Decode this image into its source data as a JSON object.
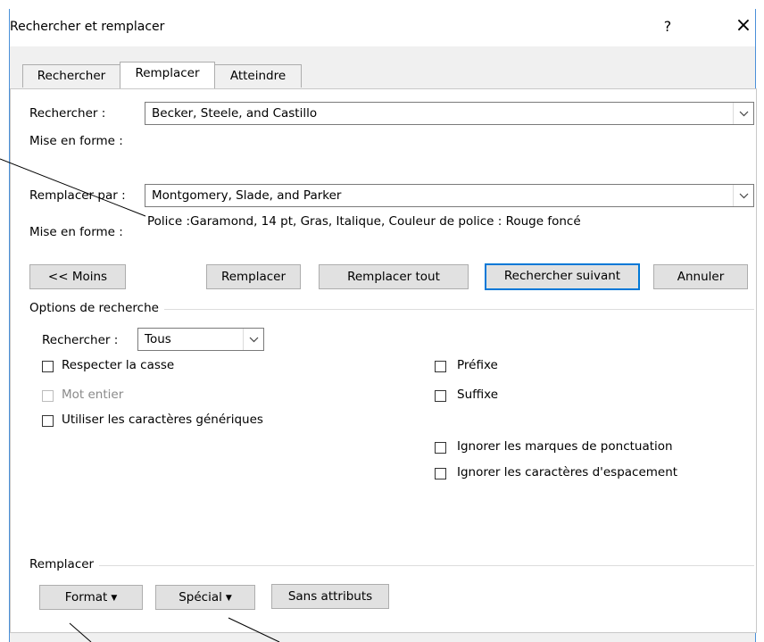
{
  "window": {
    "title": "Rechercher et remplacer",
    "help_label": "?",
    "close_label": "×"
  },
  "tabs": [
    {
      "label": "Rechercher",
      "active": false
    },
    {
      "label": "Remplacer",
      "active": true
    },
    {
      "label": "Atteindre",
      "active": false
    }
  ],
  "find": {
    "label": "Rechercher :",
    "value": "Becker, Steele, and Castillo",
    "format_label": "Mise en forme :"
  },
  "replace": {
    "label": "Remplacer par :",
    "value": "Montgomery, Slade, and Parker",
    "format_label": "Mise en forme :",
    "format_value": "Police :Garamond, 14 pt, Gras, Italique, Couleur de police : Rouge foncé"
  },
  "buttons": {
    "less": "<< Moins",
    "replace": "Remplacer",
    "replace_all": "Remplacer tout",
    "find_next": "Rechercher suivant",
    "cancel": "Annuler"
  },
  "options": {
    "title": "Options de recherche",
    "search_label": "Rechercher :",
    "search_value": "Tous",
    "left": [
      {
        "label": "Respecter la casse",
        "checked": false,
        "disabled": false
      },
      {
        "label": "Mot entier",
        "checked": false,
        "disabled": true
      },
      {
        "label": "Utiliser les caractères génériques",
        "checked": false,
        "disabled": false
      }
    ],
    "right": [
      {
        "label": "Préfixe",
        "checked": false
      },
      {
        "label": "Suffixe",
        "checked": false
      },
      {
        "label": "Ignorer les marques de ponctuation",
        "checked": false
      },
      {
        "label": "Ignorer les caractères d'espacement",
        "checked": false
      }
    ]
  },
  "replace_group": {
    "title": "Remplacer",
    "format_button": "Format",
    "special_button": "Spécial",
    "no_format_button": "Sans attributs"
  },
  "icons": {
    "dropdown": "chevron-down-icon",
    "menu_caret": "caret-down-icon"
  }
}
